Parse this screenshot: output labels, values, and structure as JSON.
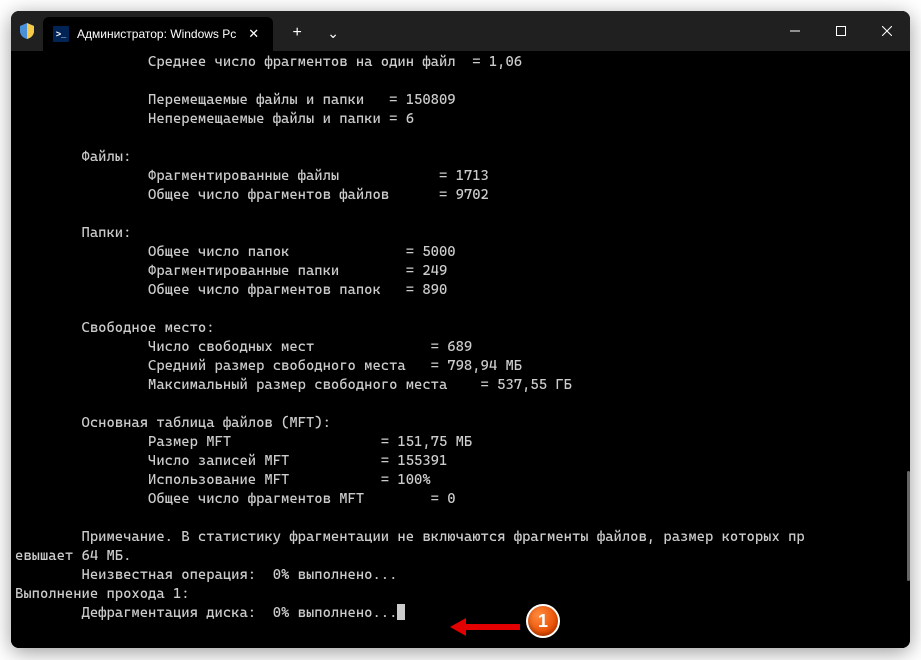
{
  "titlebar": {
    "tab_title": "Администратор: Windows Pc",
    "new_tab_symbol": "+",
    "dropdown_symbol": "⌄",
    "close_symbol": "✕",
    "minimize_symbol": "—",
    "maximize_symbol": "▢"
  },
  "terminal": {
    "lines": [
      "                Среднее число фрагментов на один файл  = 1,06",
      "",
      "                Перемещаемые файлы и папки   = 150809",
      "                Неперемещаемые файлы и папки = 6",
      "",
      "        Файлы:",
      "                Фрагментированные файлы            = 1713",
      "                Общее число фрагментов файлов      = 9702",
      "",
      "        Папки:",
      "                Общее число папок              = 5000",
      "                Фрагментированные папки        = 249",
      "                Общее число фрагментов папок   = 890",
      "",
      "        Свободное место:",
      "                Число свободных мест              = 689",
      "                Средний размер свободного места   = 798,94 МБ",
      "                Максимальный размер свободного места    = 537,55 ГБ",
      "",
      "        Основная таблица файлов (MFT):",
      "                Размер MFT                  = 151,75 МБ",
      "                Число записей MFT           = 155391",
      "                Использование MFT           = 100%",
      "                Общее число фрагментов MFT        = 0",
      "",
      "        Примечание. В статистику фрагментации не включаются фрагменты файлов, размер которых пр",
      "евышает 64 МБ.",
      "        Неизвестная операция:  0% выполнено...",
      "Выполнение прохода 1:",
      "        Дефрагментация диска:  0% выполнено..."
    ]
  },
  "annotation": {
    "badge_number": "1"
  }
}
